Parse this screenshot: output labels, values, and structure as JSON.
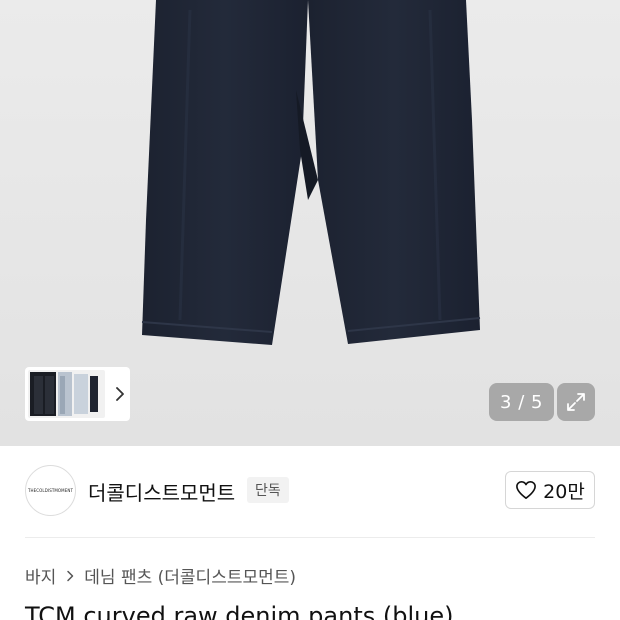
{
  "gallery": {
    "counter": "3 / 5",
    "thumbnail_alt": "thumbnail-strip"
  },
  "brand": {
    "logo_text": "THECOLDISTMOMENT",
    "name": "더콜디스트모먼트",
    "badge": "단독",
    "like_count": "20만"
  },
  "breadcrumb": {
    "items": [
      "바지",
      "데님 팬츠 (더콜디스트모먼트)"
    ]
  },
  "product": {
    "title": "TCM curved raw denim pants (blue)"
  },
  "icons": {
    "thumb_next": "chevron-right-icon",
    "expand": "expand-icon",
    "like": "heart-icon",
    "crumb_sep": "chevron-right-icon"
  }
}
